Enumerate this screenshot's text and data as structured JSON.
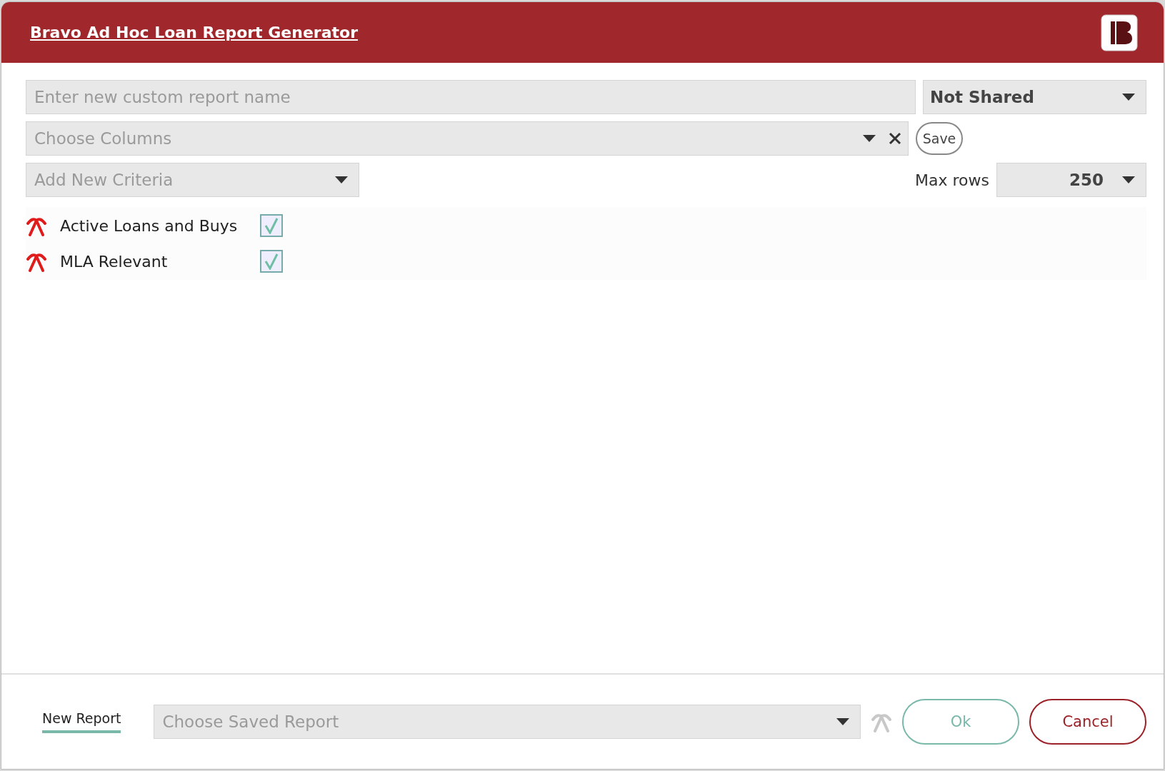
{
  "window": {
    "title": "Bravo Ad Hoc Loan Report Generator"
  },
  "report_name": {
    "placeholder": "Enter new custom report name"
  },
  "sharing": {
    "value": "Not Shared"
  },
  "columns": {
    "placeholder": "Choose Columns"
  },
  "save_button": "Save",
  "criteria_select": {
    "placeholder": "Add New Criteria"
  },
  "max_rows": {
    "label": "Max rows",
    "value": "250"
  },
  "criteria": [
    {
      "label": "Active Loans and Buys",
      "checked": true
    },
    {
      "label": "MLA Relevant",
      "checked": true
    }
  ],
  "footer": {
    "tab": {
      "label": "New Report",
      "selected": true
    },
    "saved_report": {
      "placeholder": "Choose Saved Report"
    },
    "ok": "Ok",
    "cancel": "Cancel"
  }
}
